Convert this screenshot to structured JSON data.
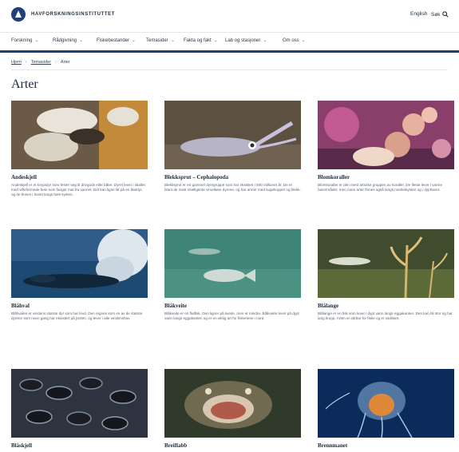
{
  "header": {
    "brand": "HAVFORSKNINGSINSTITUTTET",
    "language": "English",
    "search_label": "Søk"
  },
  "nav": {
    "items": [
      {
        "label": "Forskning"
      },
      {
        "label": "Rådgivning"
      },
      {
        "label": "Fiskebestander"
      },
      {
        "label": "Temasider"
      },
      {
        "label": "Fakta og fakt"
      },
      {
        "label": "Lab og stasjoner"
      },
      {
        "label": "Om oss"
      }
    ]
  },
  "breadcrumb": {
    "items": [
      "Hjem",
      "Temasider",
      "Arter"
    ]
  },
  "page": {
    "title": "Arter"
  },
  "cards": [
    {
      "title": "Andeskjell",
      "desc": "Andeskjell er et krepsdyr som fester seg til drivgods eller båter. Dyret lever i skallet med vifteformede bein som fanger mat fra vannet. Det kan ligne litt på en bløtdyr, og de finnes i havet langs hele kysten."
    },
    {
      "title": "Blekksprut – Cephalopoda",
      "desc": "Blekksprut er en gammel dyregruppe som har eksistert i 500 millioner år. De er blant de mest intelligente virvelløse dyrene, og har armer med sugekopper og blekk."
    },
    {
      "title": "Blomkoraller",
      "desc": "Blomkoraller er den mest artsrike gruppen av koraller. De fleste lever i varme havområder, men noen arter finnes også langs norskekysten og i dyphavet."
    },
    {
      "title": "Blåhval",
      "desc": "Blåhvalen er verdens største dyr som har levd. Den regnes som en av de største dyrene som noen gang har eksistert på jorden, og lever i alle verdenshav."
    },
    {
      "title": "Blåkveite",
      "desc": "Blåkveite er en flatfisk. Den ligner på kveite, men er mindre. Blåkveite lever på dypt vann langs eggakanten og er en viktig art for fiskeriene i nord."
    },
    {
      "title": "Blålange",
      "desc": "Blålange er en fisk som lever i dypt vann langs eggakanten. Den kan bli stor og har lang kropp. Arten er sårbar for fiske og er rødlistet."
    },
    {
      "title": "Blåskjell",
      "desc": ""
    },
    {
      "title": "Breiflabb",
      "desc": ""
    },
    {
      "title": "Brennmanet",
      "desc": ""
    }
  ]
}
